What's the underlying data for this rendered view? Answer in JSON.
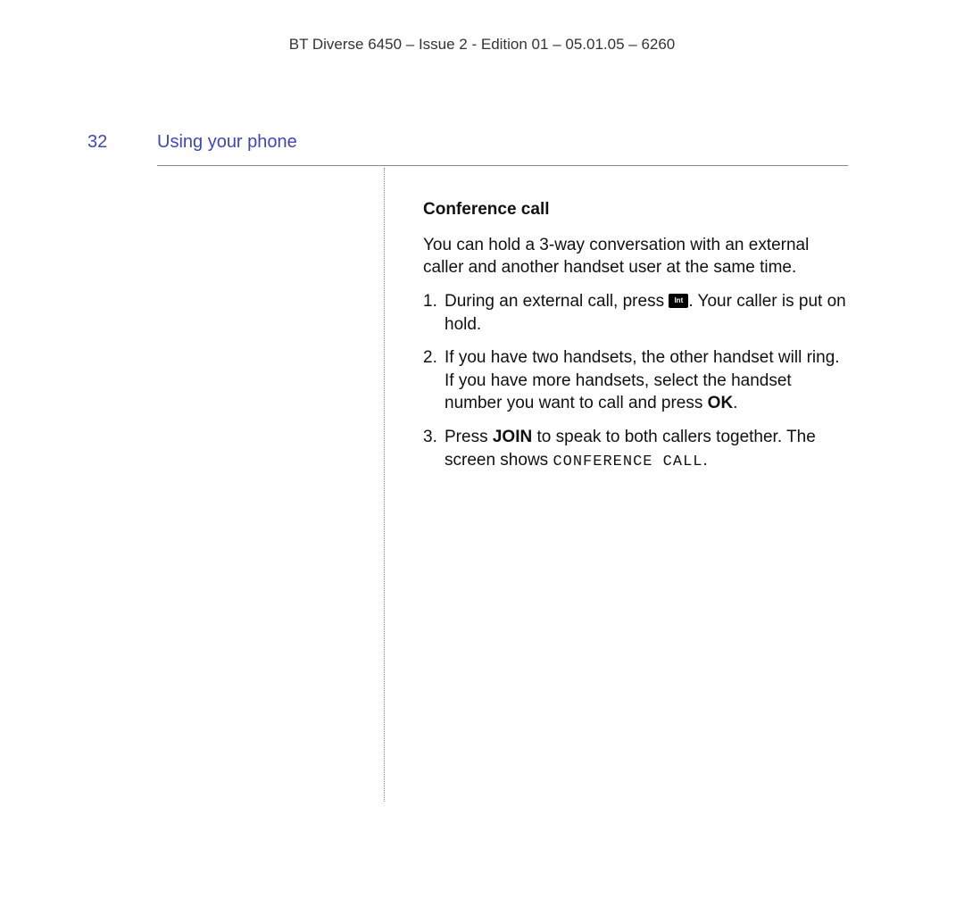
{
  "header": {
    "text": "BT Diverse 6450 – Issue 2 - Edition 01 – 05.01.05 – 6260"
  },
  "page": {
    "number": "32",
    "section_title": "Using your phone"
  },
  "content": {
    "subheading": "Conference call",
    "intro": "You can hold a 3-way conversation with an external caller and another handset user at the same time.",
    "steps": [
      {
        "num": "1.",
        "before_icon": "During an external call, press ",
        "icon_label": "Int",
        "after_icon": ". Your caller is put on hold."
      },
      {
        "num": "2.",
        "text_a": "If you have two handsets, the other handset will ring. If you have more handsets, select the handset number you want to call and press ",
        "bold_ok": "OK",
        "text_b": "."
      },
      {
        "num": "3.",
        "text_a": "Press ",
        "bold_join": "JOIN",
        "text_b": " to speak to both callers together. The screen shows ",
        "lcd": "CONFERENCE CALL",
        "text_c": "."
      }
    ]
  }
}
